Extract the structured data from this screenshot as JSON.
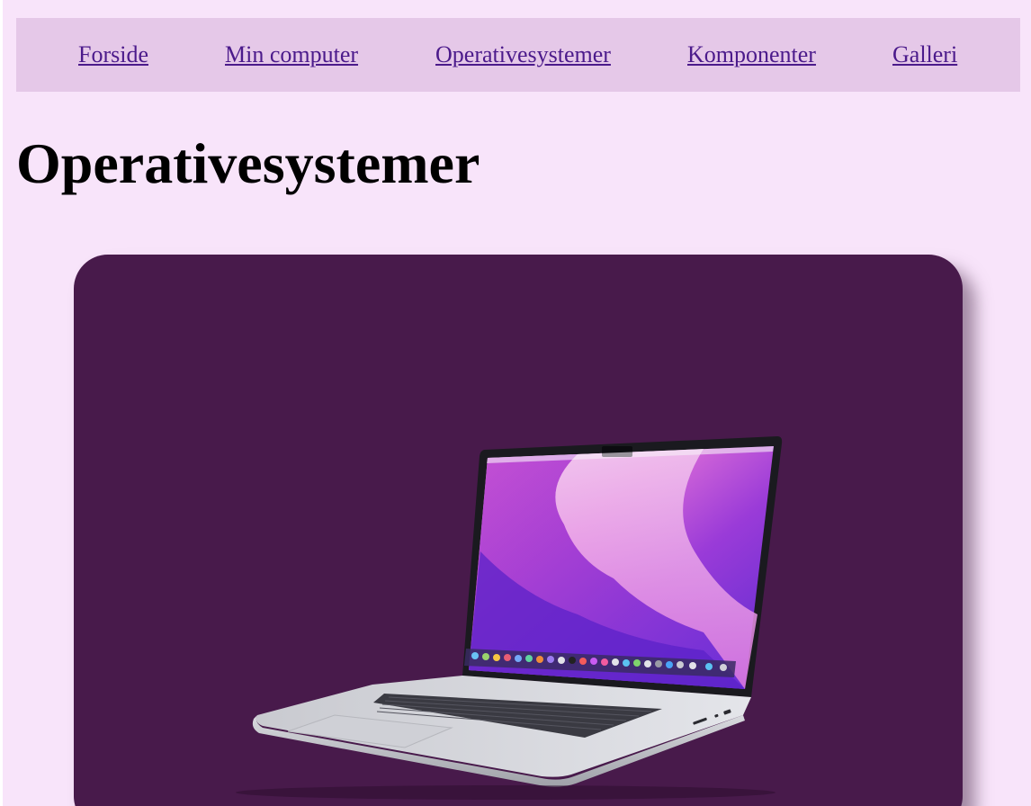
{
  "nav": {
    "items": [
      {
        "label": "Forside"
      },
      {
        "label": "Min computer"
      },
      {
        "label": "Operativesystemer"
      },
      {
        "label": "Komponenter"
      },
      {
        "label": "Galleri"
      }
    ]
  },
  "page": {
    "title": "Operativesystemer"
  },
  "hero": {
    "image_subject": "laptop-image",
    "background_color": "#481a4b"
  },
  "colors": {
    "page_background": "#f8e4fa",
    "nav_background": "#e5c8e8",
    "link": "#4b1a8b"
  }
}
